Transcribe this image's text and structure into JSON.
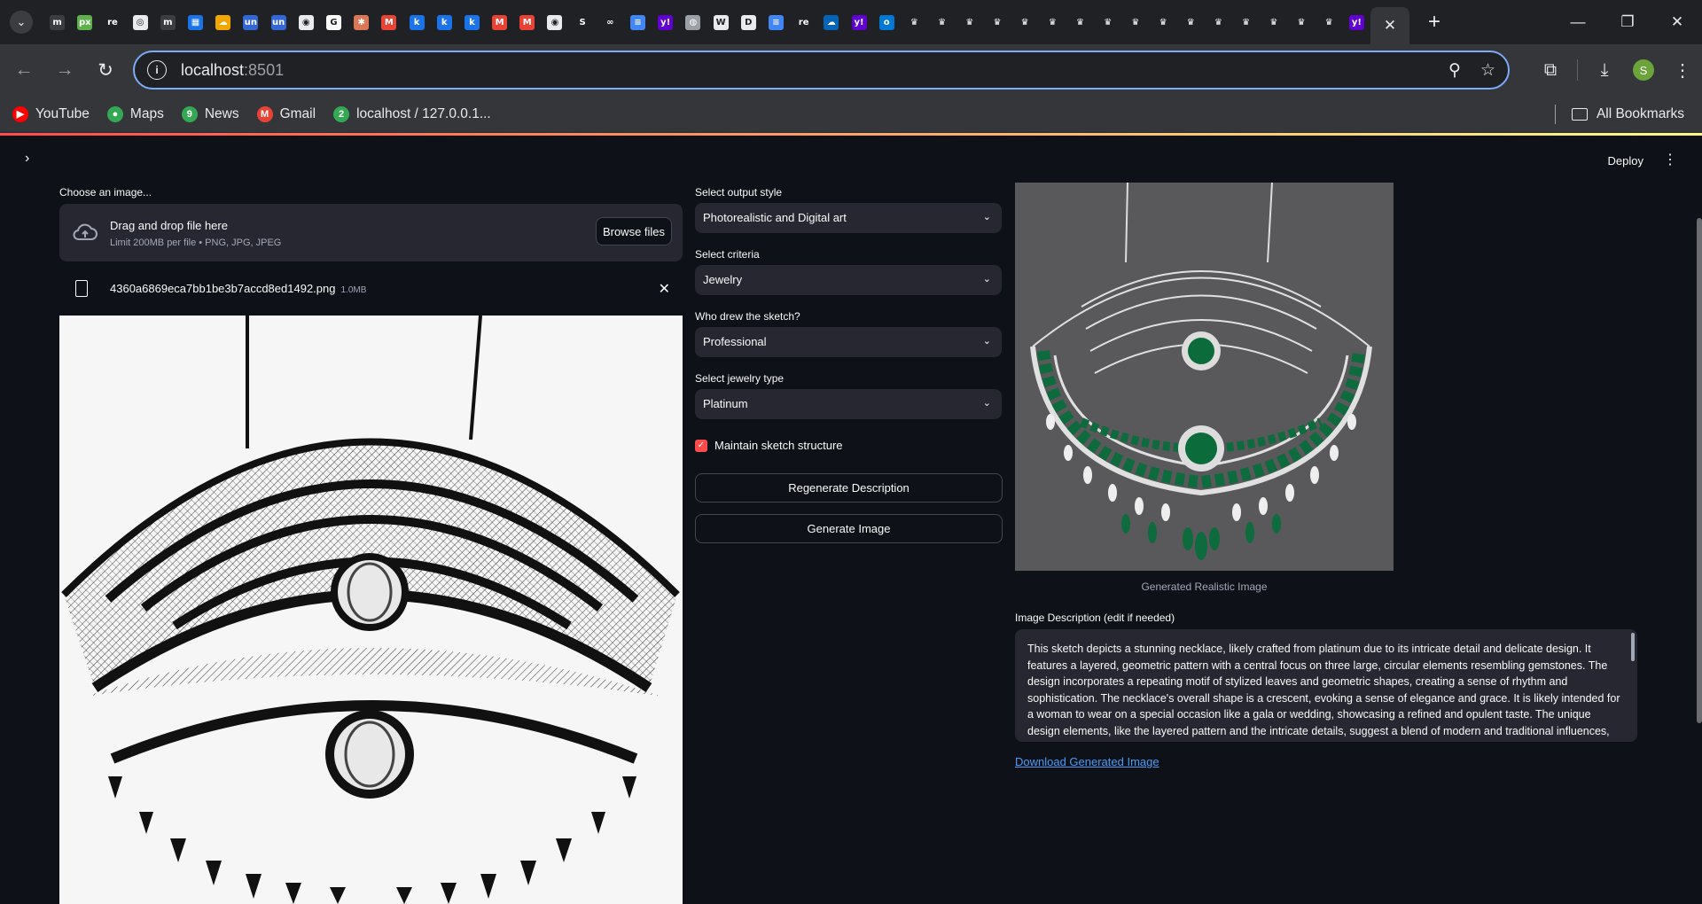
{
  "browser": {
    "tab_favicons": [
      {
        "icon": "m-icon",
        "glyph": "m",
        "color": "#3c3d40"
      },
      {
        "icon": "px-icon",
        "glyph": "px",
        "color": "#5fb14b"
      },
      {
        "icon": "re-icon",
        "glyph": "re",
        "color": "#202124"
      },
      {
        "icon": "openai-icon",
        "glyph": "◎",
        "color": "#e8eaed"
      },
      {
        "icon": "m-icon",
        "glyph": "m",
        "color": "#3c3d40"
      },
      {
        "icon": "calendar-icon",
        "glyph": "▦",
        "color": "#1a73e8"
      },
      {
        "icon": "cloud-icon",
        "glyph": "☁",
        "color": "#f2a600"
      },
      {
        "icon": "un-icon",
        "glyph": "un",
        "color": "#3367d6"
      },
      {
        "icon": "un-icon",
        "glyph": "un",
        "color": "#3367d6"
      },
      {
        "icon": "github-icon",
        "glyph": "◉",
        "color": "#e8eaed"
      },
      {
        "icon": "google-icon",
        "glyph": "G",
        "color": "#ffffff"
      },
      {
        "icon": "claude-icon",
        "glyph": "✱",
        "color": "#d97757"
      },
      {
        "icon": "gmail-icon",
        "glyph": "M",
        "color": "#ea4335"
      },
      {
        "icon": "k-icon",
        "glyph": "k",
        "color": "#1a73e8"
      },
      {
        "icon": "k-icon",
        "glyph": "k",
        "color": "#1a73e8"
      },
      {
        "icon": "k-icon",
        "glyph": "k",
        "color": "#1a73e8"
      },
      {
        "icon": "gmail-icon",
        "glyph": "M",
        "color": "#ea4335"
      },
      {
        "icon": "gmail-icon",
        "glyph": "M",
        "color": "#ea4335"
      },
      {
        "icon": "github-icon",
        "glyph": "◉",
        "color": "#e8eaed"
      },
      {
        "icon": "s-icon",
        "glyph": "S",
        "color": "#202124"
      },
      {
        "icon": "infinity-icon",
        "glyph": "∞",
        "color": "#202124"
      },
      {
        "icon": "docs-icon",
        "glyph": "≡",
        "color": "#4285f4"
      },
      {
        "icon": "yahoo-icon",
        "glyph": "y!",
        "color": "#6001d2"
      },
      {
        "icon": "globe-icon",
        "glyph": "◍",
        "color": "#9aa0a6"
      },
      {
        "icon": "w3-icon",
        "glyph": "W",
        "color": "#e8eaed"
      },
      {
        "icon": "d-icon",
        "glyph": "D",
        "color": "#e8eaed"
      },
      {
        "icon": "docs-icon",
        "glyph": "≡",
        "color": "#4285f4"
      },
      {
        "icon": "re-icon",
        "glyph": "re",
        "color": "#202124"
      },
      {
        "icon": "onedrive-icon",
        "glyph": "☁",
        "color": "#0364b8"
      },
      {
        "icon": "yahoo-icon",
        "glyph": "y!",
        "color": "#6001d2"
      },
      {
        "icon": "outlook-icon",
        "glyph": "o",
        "color": "#0078d4"
      },
      {
        "icon": "crown-icon",
        "glyph": "♛",
        "color": "#202124"
      },
      {
        "icon": "crown-icon",
        "glyph": "♛",
        "color": "#202124"
      },
      {
        "icon": "crown-icon",
        "glyph": "♛",
        "color": "#202124"
      },
      {
        "icon": "crown-icon",
        "glyph": "♛",
        "color": "#202124"
      },
      {
        "icon": "crown-icon",
        "glyph": "♛",
        "color": "#202124"
      },
      {
        "icon": "crown-icon",
        "glyph": "♛",
        "color": "#202124"
      },
      {
        "icon": "crown-icon",
        "glyph": "♛",
        "color": "#202124"
      },
      {
        "icon": "crown-icon",
        "glyph": "♛",
        "color": "#202124"
      },
      {
        "icon": "crown-icon",
        "glyph": "♛",
        "color": "#202124"
      },
      {
        "icon": "crown-icon",
        "glyph": "♛",
        "color": "#202124"
      },
      {
        "icon": "crown-icon",
        "glyph": "♛",
        "color": "#202124"
      },
      {
        "icon": "crown-icon",
        "glyph": "♛",
        "color": "#202124"
      },
      {
        "icon": "crown-icon",
        "glyph": "♛",
        "color": "#202124"
      },
      {
        "icon": "crown-icon",
        "glyph": "♛",
        "color": "#202124"
      },
      {
        "icon": "crown-icon",
        "glyph": "♛",
        "color": "#202124"
      },
      {
        "icon": "crown-icon",
        "glyph": "♛",
        "color": "#202124"
      },
      {
        "icon": "yahoo-icon",
        "glyph": "y!",
        "color": "#6001d2"
      }
    ],
    "address": {
      "host": "localhost",
      "port": ":8501"
    },
    "profile_initial": "S",
    "bookmarks": [
      {
        "label": "YouTube",
        "icon": "youtube-icon",
        "glyph": "▶",
        "color": "#ff0000"
      },
      {
        "label": "Maps",
        "icon": "maps-icon",
        "glyph": "●",
        "color": "#34a853"
      },
      {
        "label": "News",
        "icon": "news-icon",
        "glyph": "9",
        "color": "#34a853"
      },
      {
        "label": "Gmail",
        "icon": "gmail-icon",
        "glyph": "M",
        "color": "#ea4335"
      },
      {
        "label": "localhost / 127.0.0.1...",
        "icon": "phpmyadmin-icon",
        "glyph": "2",
        "color": "#34a853"
      }
    ],
    "all_bookmarks": "All Bookmarks"
  },
  "app": {
    "deploy": "Deploy",
    "uploader": {
      "label": "Choose an image...",
      "drop_title": "Drag and drop file here",
      "drop_limit": "Limit 200MB per file • PNG, JPG, JPEG",
      "browse": "Browse files",
      "file_name": "4360a6869eca7bb1be3b7accd8ed1492.png",
      "file_size": "1.0MB"
    },
    "controls": {
      "output_style_label": "Select output style",
      "output_style_value": "Photorealistic and Digital art",
      "criteria_label": "Select criteria",
      "criteria_value": "Jewelry",
      "drawer_label": "Who drew the sketch?",
      "drawer_value": "Professional",
      "jewelry_type_label": "Select jewelry type",
      "jewelry_type_value": "Platinum",
      "maintain_label": "Maintain sketch structure",
      "maintain_checked": true,
      "regenerate": "Regenerate Description",
      "generate": "Generate Image"
    },
    "output": {
      "caption": "Generated Realistic Image",
      "description_label": "Image Description (edit if needed)",
      "description_text": "This sketch depicts a stunning necklace, likely crafted from platinum due to its intricate detail and delicate design. It features a layered, geometric pattern with a central focus on three large, circular elements resembling gemstones.  The design incorporates a repeating motif of stylized leaves and geometric shapes, creating a sense of rhythm and sophistication. The necklace's overall shape is a crescent, evoking a sense of elegance and grace. It is likely intended for a woman to wear on a special occasion like a gala or wedding, showcasing a refined and opulent taste. The unique design elements, like the layered pattern and the intricate details, suggest a blend of modern and traditional influences, creating",
      "download": "Download Generated Image"
    },
    "accent_color": "#ff4b4b"
  }
}
